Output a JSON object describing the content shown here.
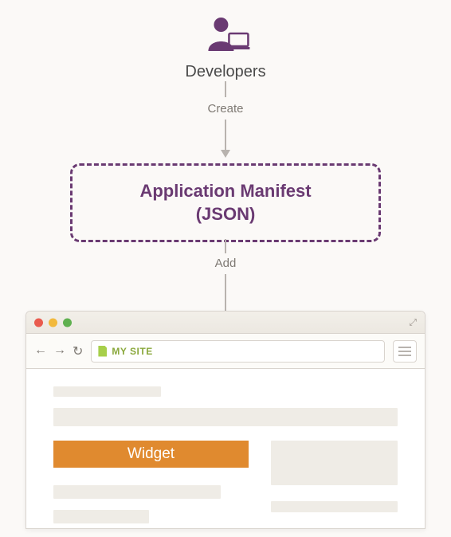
{
  "diagram": {
    "developer_label": "Developers",
    "step1_label": "Create",
    "step2_label": "Add",
    "manifest_line1": "Application Manifest",
    "manifest_line2": "(JSON)"
  },
  "browser": {
    "site_name": "MY SITE",
    "widget_label": "Widget"
  },
  "colors": {
    "accent_purple": "#6a3a72",
    "accent_orange": "#e08a2f",
    "accent_green": "#8aa83c"
  }
}
